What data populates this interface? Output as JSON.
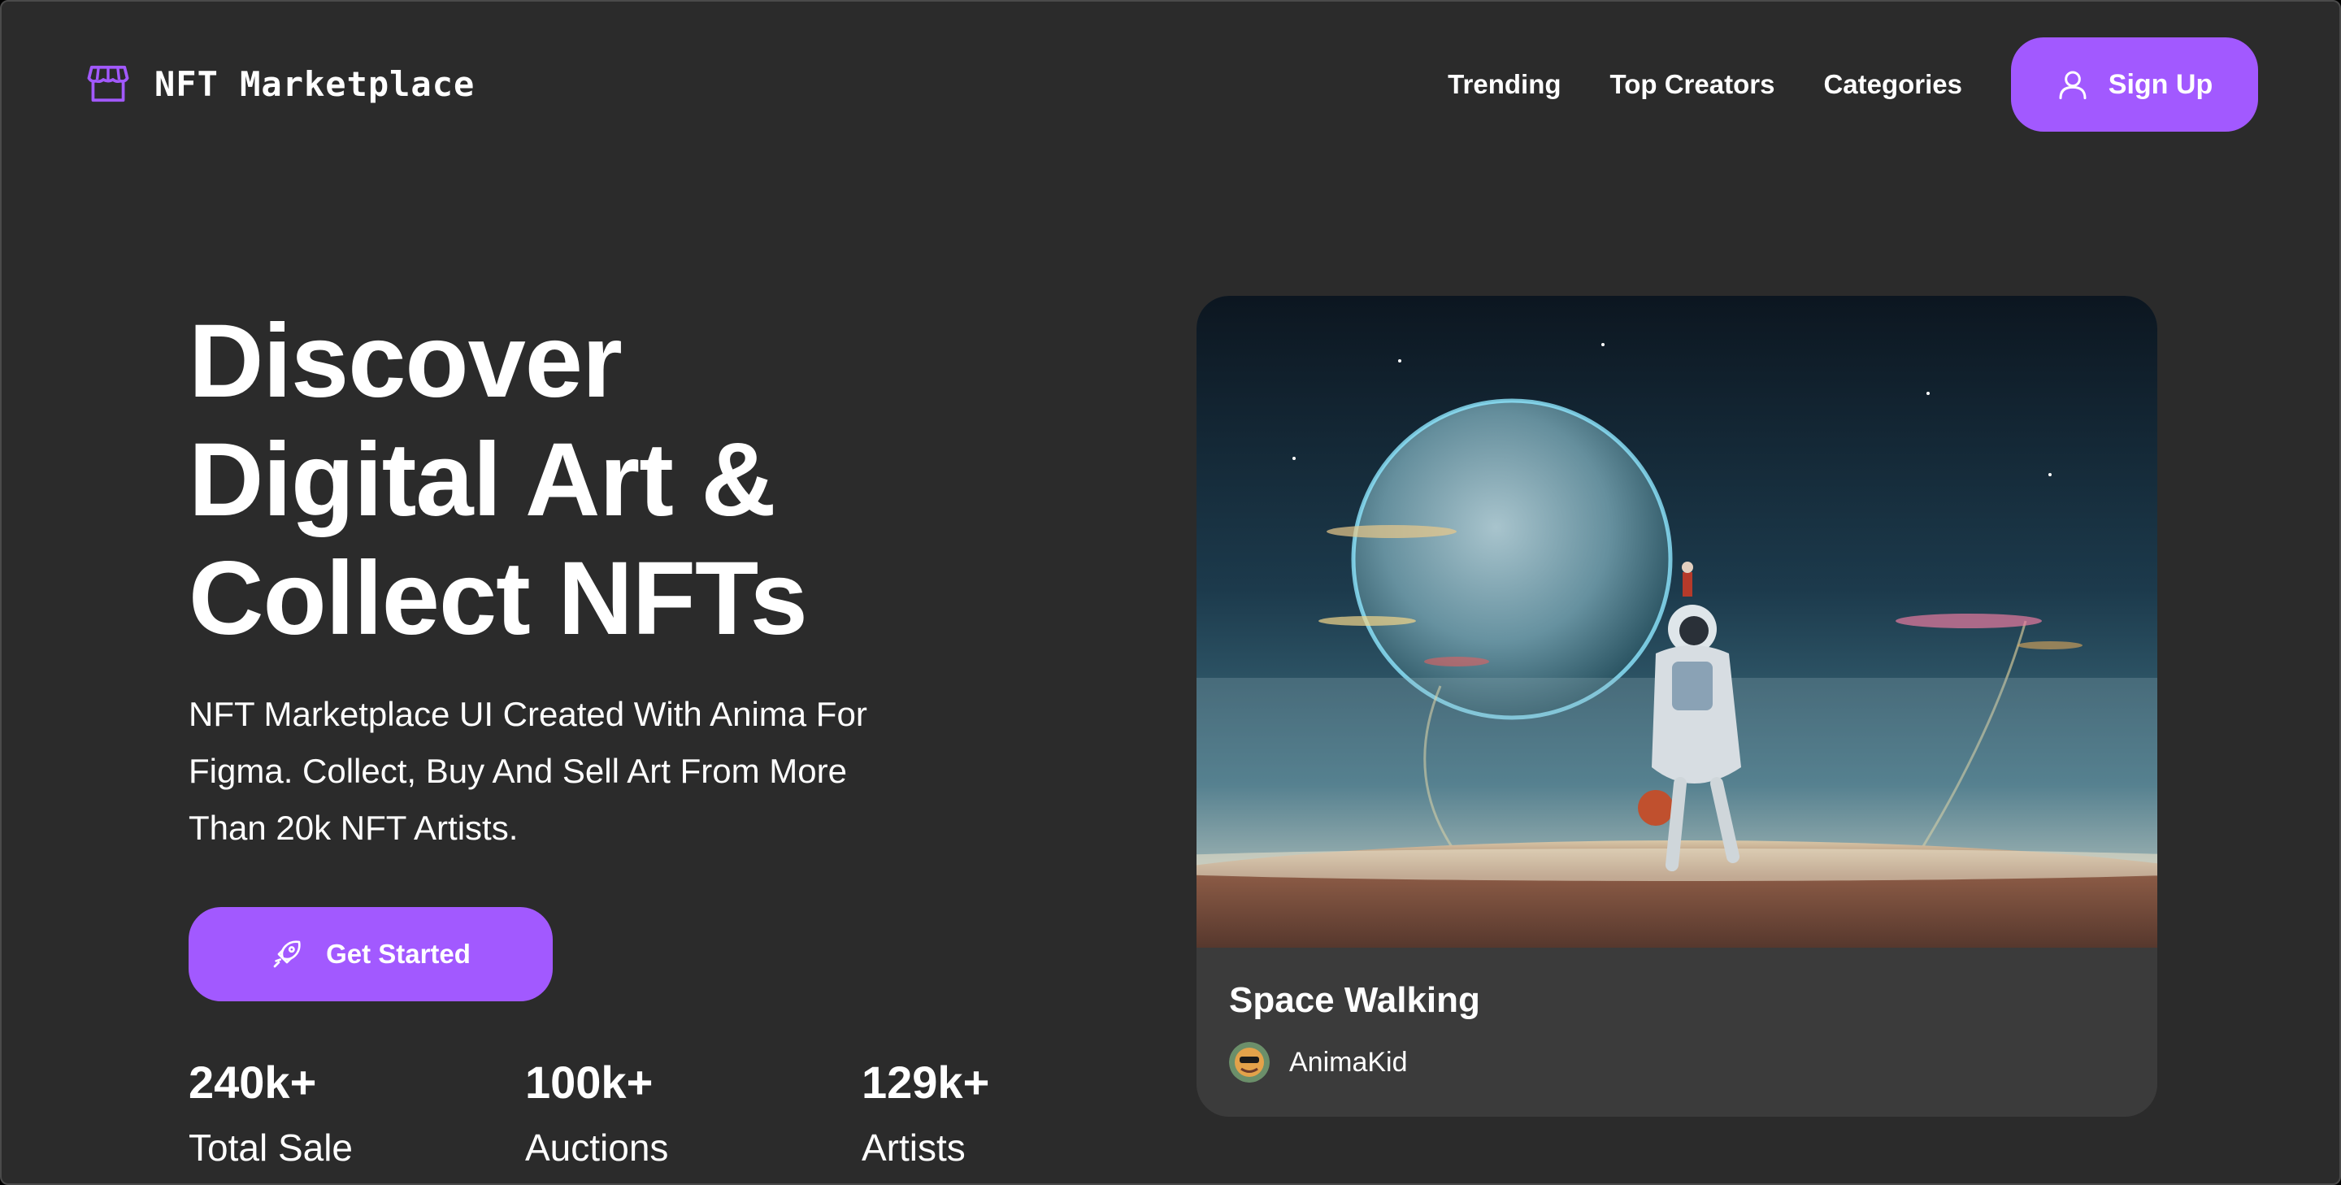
{
  "brand": {
    "name": "NFT Marketplace",
    "icon": "storefront-icon",
    "accent": "#a259ff"
  },
  "nav": {
    "links": [
      "Trending",
      "Top Creators",
      "Categories"
    ],
    "signup_label": "Sign Up",
    "signup_icon": "user-icon"
  },
  "hero": {
    "title_lines": [
      "Discover",
      "Digital Art &",
      "Collect NFTs"
    ],
    "subtitle_lines": [
      "NFT Marketplace UI Created With Anima For",
      "Figma. Collect, Buy And Sell Art From More",
      "Than 20k NFT Artists."
    ],
    "cta_label": "Get Started",
    "cta_icon": "rocket-icon"
  },
  "stats": [
    {
      "value": "240k+",
      "label": "Total Sale"
    },
    {
      "value": "100k+",
      "label": "Auctions"
    },
    {
      "value": "129k+",
      "label": "Artists"
    }
  ],
  "featured": {
    "title": "Space Walking",
    "artist": "AnimaKid",
    "background": "#3b3b3b"
  },
  "colors": {
    "background": "#2b2b2b",
    "card": "#3b3b3b",
    "text": "#ffffff"
  }
}
